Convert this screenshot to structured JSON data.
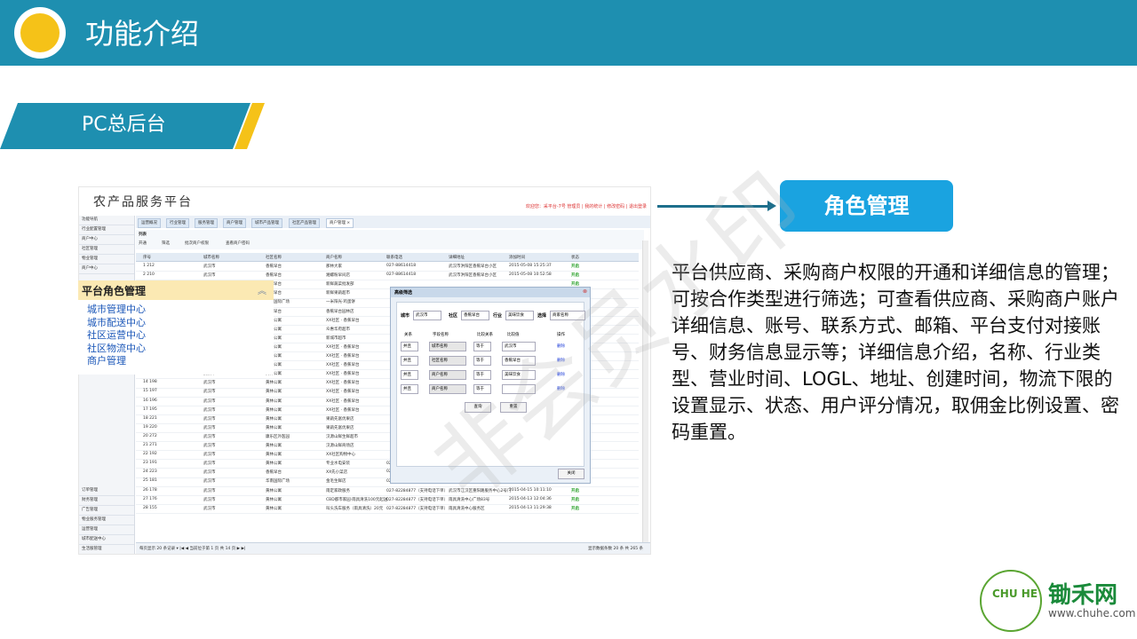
{
  "header": {
    "title": "功能介绍"
  },
  "section": {
    "title": "PC总后台"
  },
  "role_box": {
    "label": "角色管理"
  },
  "description": "平台供应商、采购商户权限的开通和详细信息的管理；可按合作类型进行筛选；可查看供应商、采购商户账户详细信息、账号、联系方式、邮箱、平台支付对接账号、财务信息显示等；详细信息介绍，名称、行业类型、营业时间、LOGL、地址、创建时间，物流下限的设置显示、状态、用户评分情况，取佣金比例设置、密码重置。",
  "screenshot": {
    "app_title": "农产品服务平台",
    "welcome": "欢迎您：采平台-7号 管理员 | 我的统计 | 修改密码 | 退出登录",
    "nav_top": [
      "功能导航",
      "行业配置管理",
      "商户中心",
      "社区管理",
      "物业管理",
      "商户中心"
    ],
    "nav_bottom": [
      "订单管理",
      "财务管理",
      "广告管理",
      "物业服务管理",
      "运营管理",
      "城市配送中心",
      "生活服管理"
    ],
    "tabs": [
      "运营概况",
      "行业管理",
      "服务管理",
      "商户管理",
      "城市产品管理",
      "社区产品管理",
      "商户管理 ×"
    ],
    "toolbar": [
      "开通",
      "筛选",
      "批次商户权限",
      "查看商户密码"
    ],
    "columns": [
      "序号",
      "城市名称",
      "社区名称",
      "商户名称",
      "联系电话",
      "详细地址",
      "添加时间",
      "状态"
    ],
    "rows": [
      {
        "no": "1 212",
        "city": "武汉市",
        "community": "香蕉早台",
        "name": "那林大家",
        "phone": "027-88614418",
        "addr": "武汉市洪阳区香蕉早台小区",
        "time": "2015-05-08 15:25:37",
        "status": "开启"
      },
      {
        "no": "2 210",
        "city": "武汉市",
        "community": "香蕉早台",
        "name": "湘螺粉早间店",
        "phone": "027-88614418",
        "addr": "武汉市洪阳区香蕉早台小区",
        "time": "2015-05-08 10:52:58",
        "status": "开启"
      },
      {
        "no": "",
        "city": "武汉市",
        "community": "香蕉早台",
        "name": "新鲜蔬菜批发部",
        "phone": "",
        "addr": "",
        "time": "",
        "status": "开启"
      },
      {
        "no": "",
        "city": "武汉市",
        "community": "香蕉早台",
        "name": "新鲜果蔬超市",
        "phone": "",
        "addr": "",
        "time": "",
        "status": ""
      },
      {
        "no": "",
        "city": "武汉市",
        "community": "华南国际广场",
        "name": "一米阳光·鸡蛋饼",
        "phone": "",
        "addr": "",
        "time": "",
        "status": ""
      },
      {
        "no": "",
        "city": "武汉市",
        "community": "香蕉早台",
        "name": "香蕉早台园林店",
        "phone": "",
        "addr": "",
        "time": "",
        "status": ""
      },
      {
        "no": "",
        "city": "武汉市",
        "community": "黄林公寓",
        "name": "XX社区 · 香蕉早台",
        "phone": "",
        "addr": "",
        "time": "",
        "status": ""
      },
      {
        "no": "",
        "city": "武汉市",
        "community": "黄林公寓",
        "name": "众惠华府超市",
        "phone": "",
        "addr": "",
        "time": "",
        "status": ""
      },
      {
        "no": "",
        "city": "武汉市",
        "community": "黄林公寓",
        "name": "新城市超市",
        "phone": "",
        "addr": "",
        "time": "",
        "status": ""
      },
      {
        "no": "",
        "city": "武汉市",
        "community": "黄林公寓",
        "name": "XX社区 · 香蕉早台",
        "phone": "",
        "addr": "",
        "time": "",
        "status": ""
      },
      {
        "no": "11 201",
        "city": "武汉市",
        "community": "黄林公寓",
        "name": "XX社区 · 香蕉早台",
        "phone": "",
        "addr": "",
        "time": "",
        "status": ""
      },
      {
        "no": "12 200",
        "city": "武汉市",
        "community": "黄林公寓",
        "name": "XX社区 · 香蕉早台",
        "phone": "",
        "addr": "",
        "time": "",
        "status": ""
      },
      {
        "no": "13 199",
        "city": "武汉市",
        "community": "黄林公寓",
        "name": "XX社区 · 香蕉早台",
        "phone": "",
        "addr": "",
        "time": "",
        "status": ""
      },
      {
        "no": "14 198",
        "city": "武汉市",
        "community": "黄林公寓",
        "name": "XX社区 · 香蕉早台",
        "phone": "",
        "addr": "",
        "time": "",
        "status": ""
      },
      {
        "no": "15 197",
        "city": "武汉市",
        "community": "黄林公寓",
        "name": "XX社区 · 香蕉早台",
        "phone": "",
        "addr": "",
        "time": "",
        "status": ""
      },
      {
        "no": "16 196",
        "city": "武汉市",
        "community": "黄林公寓",
        "name": "XX社区 · 香蕉早台",
        "phone": "",
        "addr": "",
        "time": "",
        "status": ""
      },
      {
        "no": "17 195",
        "city": "武汉市",
        "community": "黄林公寓",
        "name": "XX社区 · 香蕉早台",
        "phone": "",
        "addr": "",
        "time": "",
        "status": ""
      },
      {
        "no": "18 221",
        "city": "武汉市",
        "community": "黄林公寓",
        "name": "果蔬先富优果店",
        "phone": "",
        "addr": "",
        "time": "",
        "status": ""
      },
      {
        "no": "19 220",
        "city": "武汉市",
        "community": "黄林公寓",
        "name": "果蔬先富优果店",
        "phone": "",
        "addr": "",
        "time": "",
        "status": ""
      },
      {
        "no": "20 272",
        "city": "武汉市",
        "community": "康乐区外医园",
        "name": "汉源山鲜生鲜超市",
        "phone": "",
        "addr": "",
        "time": "",
        "status": ""
      },
      {
        "no": "21 271",
        "city": "武汉市",
        "community": "黄林公寓",
        "name": "汉源山鲜商场店",
        "phone": "",
        "addr": "",
        "time": "",
        "status": ""
      },
      {
        "no": "22 192",
        "city": "武汉市",
        "community": "黄林公寓",
        "name": "XX社区购物中心",
        "phone": "",
        "addr": "",
        "time": "",
        "status": ""
      },
      {
        "no": "23 191",
        "city": "武汉市",
        "community": "黄林公寓",
        "name": "专业水电安装",
        "phone": "027-82284877（支持电话下单）",
        "addr": "武汉市洪阳区马处路9号",
        "time": "2015-04-16 11:51:07",
        "status": "开启"
      },
      {
        "no": "24 223",
        "city": "武汉市",
        "community": "香蕉早台",
        "name": "XX先小菜店",
        "phone": "027-88614418",
        "addr": "武汉市洪阳区马处路香蕉早台小区",
        "time": "2015-04-02 08:18:42",
        "status": "开启"
      },
      {
        "no": "25 181",
        "city": "武汉市",
        "community": "华南国际广场",
        "name": "金毛生鲜店",
        "phone": "027-82284877（支持电话下单）",
        "addr": "武汉市江汉区马场路服务中心",
        "time": "2015-04-16 13:24:46",
        "status": "开启"
      },
      {
        "no": "26 178",
        "city": "武汉市",
        "community": "黄林公寓",
        "name": "雨定家政服务",
        "phone": "027-82284877（支持电话下单）",
        "addr": "武汉市江汉区重阳路服务中心2号门",
        "time": "2015-04-15 10:11:10",
        "status": "开启"
      },
      {
        "no": "27 176",
        "city": "武汉市",
        "community": "黄林公寓",
        "name": "CBD都市家园·雨具清洗100元起送",
        "phone": "027-82284877（支持电话下单）",
        "addr": "雨具清洗中心广场83号",
        "time": "2015-04-13 12:04:36",
        "status": "开启"
      },
      {
        "no": "28 155",
        "city": "武汉市",
        "community": "黄林公寓",
        "name": "叫头洗车服务（雨具清洗）20元",
        "phone": "027-82284877（支持电话下单）",
        "addr": "雨具清洗中心服务区",
        "time": "2015-04-13 11:29:38",
        "status": "开启"
      }
    ],
    "pager": {
      "left": "每页显示 20 条记录 ▾   |◀ ◀  当前位于第 1 页 共 14 页  ▶ ▶|",
      "right": "显示数据条数 20 条 共 265 条"
    },
    "menu": {
      "title": "平台角色管理",
      "items": [
        "城市管理中心",
        "城市配送中心",
        "社区运营中心",
        "社区物流中心",
        "商户管理"
      ]
    },
    "dialog": {
      "title": "高级筛选",
      "filters": [
        {
          "label": "城市",
          "value": "武汉市"
        },
        {
          "label": "社区",
          "value": "香蕉早台"
        },
        {
          "label": "行业",
          "value": "美味饮食"
        },
        {
          "label": "选择",
          "value": "商家名称"
        }
      ],
      "columns": [
        "关系",
        "字段名称",
        "比较关系",
        "比较值",
        "操作"
      ],
      "rows": [
        {
          "rel": "并且",
          "field": "城市名称",
          "op": "等于",
          "val": "武汉市",
          "action": "删除"
        },
        {
          "rel": "并且",
          "field": "社区名称",
          "op": "等于",
          "val": "香蕉早台",
          "action": "删除"
        },
        {
          "rel": "并且",
          "field": "商户名称",
          "op": "等于",
          "val": "美味饮食",
          "action": "删除"
        },
        {
          "rel": "并且",
          "field": "商户名称",
          "op": "等于",
          "val": "",
          "action": "删除"
        }
      ],
      "query_btn": "查询",
      "reset_btn": "重置",
      "close_btn": "关闭"
    }
  },
  "watermark": "非会员水印",
  "brand": {
    "name": "锄禾网",
    "url": "www.chuhe.com",
    "logo_text": "CHU HE",
    "colors": {
      "primary": "#1e8fb0",
      "accent": "#f5c218",
      "brand": "#1a8a3a"
    }
  }
}
